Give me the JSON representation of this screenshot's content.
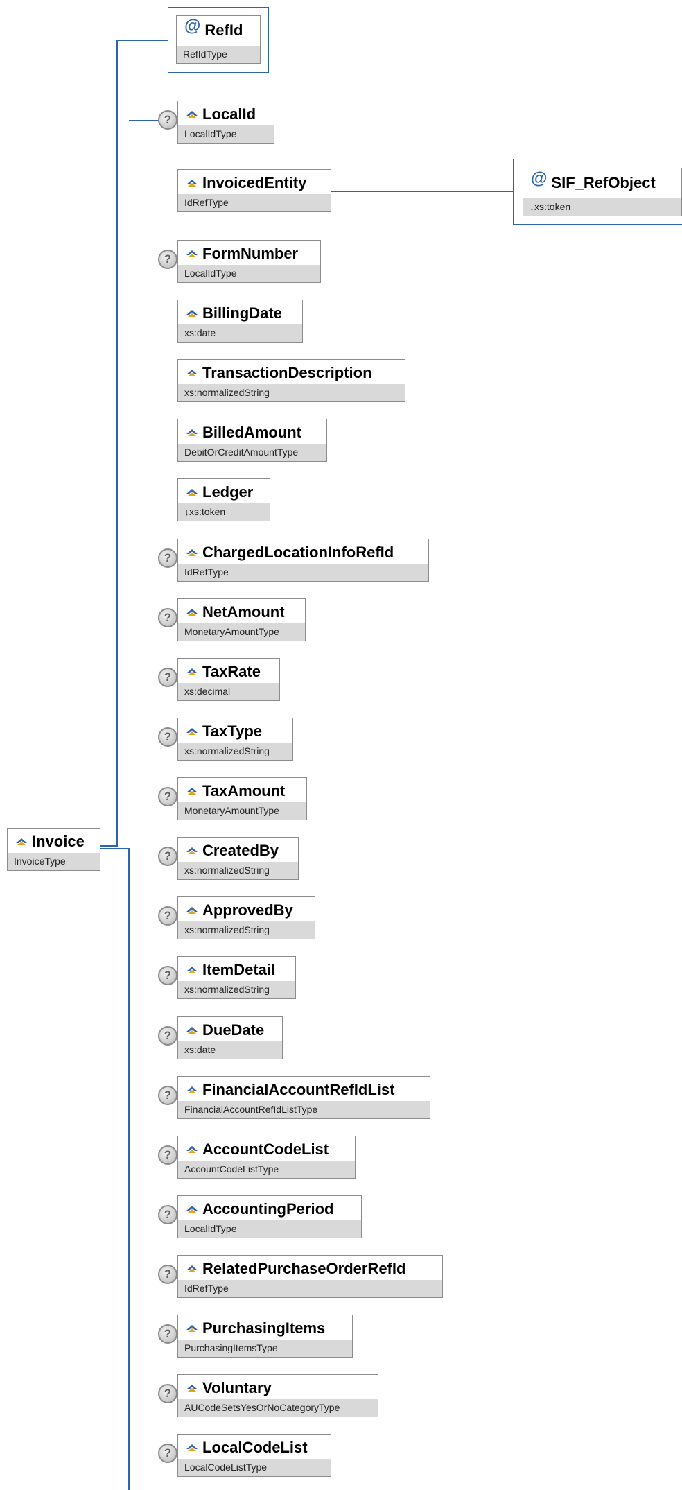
{
  "colors": {
    "connector": "#2e65a8",
    "box_border": "#8c8c8c",
    "type_band": "#d9d9d9"
  },
  "root": {
    "name": "Invoice",
    "type": "InvoiceType",
    "icon": "element-icon"
  },
  "attribute": {
    "name": "RefId",
    "type": "RefIdType",
    "icon": "attribute-icon"
  },
  "ref_attribute": {
    "name": "SIF_RefObject",
    "type": "↓xs:token",
    "icon": "attribute-icon"
  },
  "help_icon": "?",
  "children": [
    {
      "name": "LocalId",
      "type": "LocalIdType",
      "optional": true
    },
    {
      "name": "InvoicedEntity",
      "type": "IdRefType",
      "optional": false
    },
    {
      "name": "FormNumber",
      "type": "LocalIdType",
      "optional": true
    },
    {
      "name": "BillingDate",
      "type": "xs:date",
      "optional": false
    },
    {
      "name": "TransactionDescription",
      "type": "xs:normalizedString",
      "optional": false
    },
    {
      "name": "BilledAmount",
      "type": "DebitOrCreditAmountType",
      "optional": false
    },
    {
      "name": "Ledger",
      "type": "↓xs:token",
      "optional": false
    },
    {
      "name": "ChargedLocationInfoRefId",
      "type": "IdRefType",
      "optional": true
    },
    {
      "name": "NetAmount",
      "type": "MonetaryAmountType",
      "optional": true
    },
    {
      "name": "TaxRate",
      "type": "xs:decimal",
      "optional": true
    },
    {
      "name": "TaxType",
      "type": "xs:normalizedString",
      "optional": true
    },
    {
      "name": "TaxAmount",
      "type": "MonetaryAmountType",
      "optional": true
    },
    {
      "name": "CreatedBy",
      "type": "xs:normalizedString",
      "optional": true
    },
    {
      "name": "ApprovedBy",
      "type": "xs:normalizedString",
      "optional": true
    },
    {
      "name": "ItemDetail",
      "type": "xs:normalizedString",
      "optional": true
    },
    {
      "name": "DueDate",
      "type": "xs:date",
      "optional": true
    },
    {
      "name": "FinancialAccountRefIdList",
      "type": "FinancialAccountRefIdListType",
      "optional": true
    },
    {
      "name": "AccountCodeList",
      "type": "AccountCodeListType",
      "optional": true
    },
    {
      "name": "AccountingPeriod",
      "type": "LocalIdType",
      "optional": true
    },
    {
      "name": "RelatedPurchaseOrderRefId",
      "type": "IdRefType",
      "optional": true
    },
    {
      "name": "PurchasingItems",
      "type": "PurchasingItemsType",
      "optional": true
    },
    {
      "name": "Voluntary",
      "type": "AUCodeSetsYesOrNoCategoryType",
      "optional": true
    },
    {
      "name": "LocalCodeList",
      "type": "LocalCodeListType",
      "optional": true
    }
  ]
}
